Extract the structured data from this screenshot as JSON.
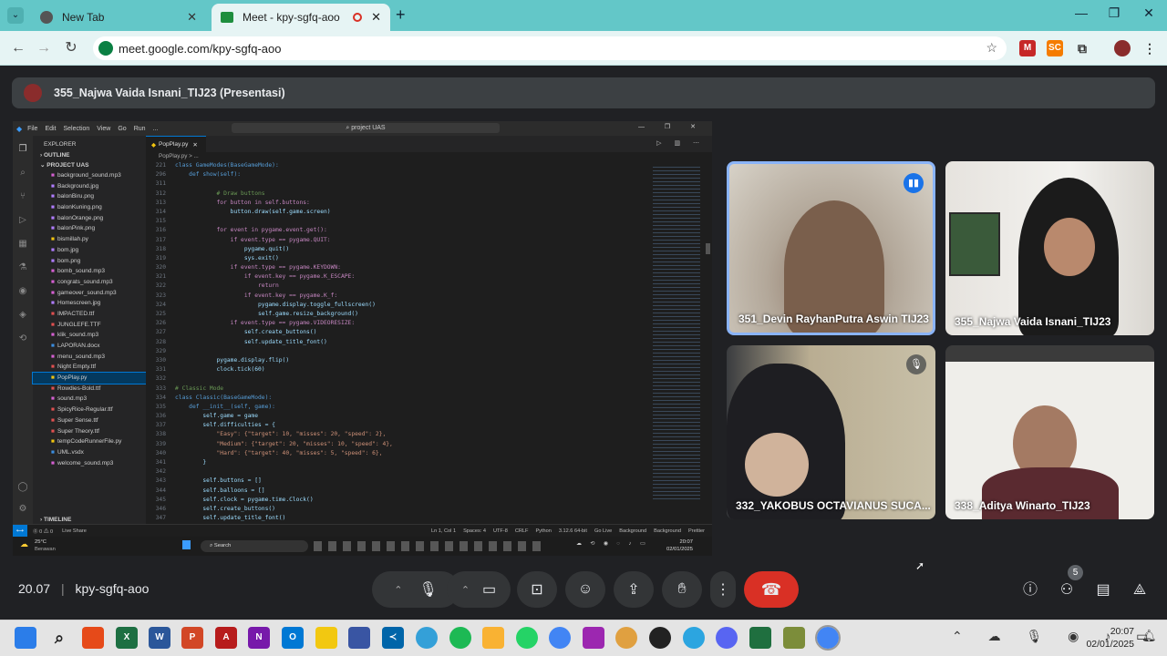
{
  "browser": {
    "tabs": [
      {
        "label": "New Tab"
      },
      {
        "label": "Meet - kpy-sgfq-aoo"
      }
    ],
    "url": "meet.google.com/kpy-sgfq-aoo"
  },
  "meet": {
    "presenter_label": "355_Najwa Vaida Isnani_TIJ23 (Presentasi)",
    "participants": [
      {
        "name": "351_Devin RayhanPutra Aswin TIJ23",
        "status": "speaking"
      },
      {
        "name": "355_Najwa Vaida Isnani_TIJ23",
        "status": ""
      },
      {
        "name": "332_YAKOBUS OCTAVIANUS SUCA...",
        "status": "muted"
      },
      {
        "name": "338_Aditya Winarto_TIJ23",
        "status": ""
      }
    ],
    "time": "20.07",
    "meeting_code": "kpy-sgfq-aoo",
    "people_count": "5"
  },
  "vscode": {
    "menu": [
      "File",
      "Edit",
      "Selection",
      "View",
      "Go",
      "Run",
      "..."
    ],
    "search": "project UAS",
    "explorer_title": "EXPLORER",
    "outline": "OUTLINE",
    "project": "PROJECT UAS",
    "files": [
      "background_sound.mp3",
      "Background.jpg",
      "balonBiru.png",
      "balonKuning.png",
      "balonOrange.png",
      "balonPink.png",
      "bismillah.py",
      "bom.jpg",
      "bom.png",
      "bomb_sound.mp3",
      "congrats_sound.mp3",
      "gameover_sound.mp3",
      "Homescreen.jpg",
      "IMPACTED.ttf",
      "JUNGLEFE.TTF",
      "klik_sound.mp3",
      "LAPORAN.docx",
      "menu_sound.mp3",
      "Night Empty.ttf",
      "PopPlay.py",
      "Rowdies-Bold.ttf",
      "sound.mp3",
      "SpicyRice-Regular.ttf",
      "Super Sense.ttf",
      "Super Theory.ttf",
      "tempCodeRunnerFile.py",
      "UML.vsdx",
      "welcome_sound.mp3"
    ],
    "timeline": "TIMELINE",
    "tab": "PopPlay.py",
    "breadcrumb": "PopPlay.py > ...",
    "code": [
      [
        "221",
        "class GameModes(BaseGameMode):"
      ],
      [
        "296",
        "    def show(self):"
      ],
      [
        "311",
        ""
      ],
      [
        "312",
        "            # Draw buttons"
      ],
      [
        "313",
        "            for button in self.buttons:"
      ],
      [
        "314",
        "                button.draw(self.game.screen)"
      ],
      [
        "315",
        ""
      ],
      [
        "316",
        "            for event in pygame.event.get():"
      ],
      [
        "317",
        "                if event.type == pygame.QUIT:"
      ],
      [
        "318",
        "                    pygame.quit()"
      ],
      [
        "319",
        "                    sys.exit()"
      ],
      [
        "320",
        "                if event.type == pygame.KEYDOWN:"
      ],
      [
        "321",
        "                    if event.key == pygame.K_ESCAPE:"
      ],
      [
        "322",
        "                        return"
      ],
      [
        "323",
        "                    if event.key == pygame.K_f:"
      ],
      [
        "324",
        "                        pygame.display.toggle_fullscreen()"
      ],
      [
        "325",
        "                        self.game.resize_background()"
      ],
      [
        "326",
        "                if event.type == pygame.VIDEORESIZE:"
      ],
      [
        "327",
        "                    self.create_buttons()"
      ],
      [
        "328",
        "                    self.update_title_font()"
      ],
      [
        "329",
        ""
      ],
      [
        "330",
        "            pygame.display.flip()"
      ],
      [
        "331",
        "            clock.tick(60)"
      ],
      [
        "332",
        ""
      ],
      [
        "333",
        "# Classic Mode"
      ],
      [
        "334",
        "class Classic(BaseGameMode):"
      ],
      [
        "335",
        "    def __init__(self, game):"
      ],
      [
        "336",
        "        self.game = game"
      ],
      [
        "337",
        "        self.difficulties = {"
      ],
      [
        "338",
        "            \"Easy\": {\"target\": 10, \"misses\": 20, \"speed\": 2},"
      ],
      [
        "339",
        "            \"Medium\": {\"target\": 20, \"misses\": 10, \"speed\": 4},"
      ],
      [
        "340",
        "            \"Hard\": {\"target\": 40, \"misses\": 5, \"speed\": 6},"
      ],
      [
        "341",
        "        }"
      ],
      [
        "342",
        ""
      ],
      [
        "343",
        "        self.buttons = []"
      ],
      [
        "344",
        "        self.balloons = []"
      ],
      [
        "345",
        "        self.clock = pygame.time.Clock()"
      ],
      [
        "346",
        "        self.create_buttons()"
      ],
      [
        "347",
        "        self.update_title_font()"
      ]
    ],
    "status": [
      "⓪ 0 ⚠ 0",
      "Live Share",
      "Ln 1, Col 1",
      "Spaces: 4",
      "UTF-8",
      "CRLF",
      "Python",
      "3.12.6 64-bit",
      "Go Live",
      "Background",
      "Background",
      "Prettier"
    ],
    "weather_temp": "25°C",
    "weather_desc": "Berawan",
    "search_placeholder": "Search",
    "inner_time": "20:07",
    "inner_date": "02/01/2025"
  },
  "taskbar": {
    "time": "20:07",
    "date": "02/01/2025"
  }
}
